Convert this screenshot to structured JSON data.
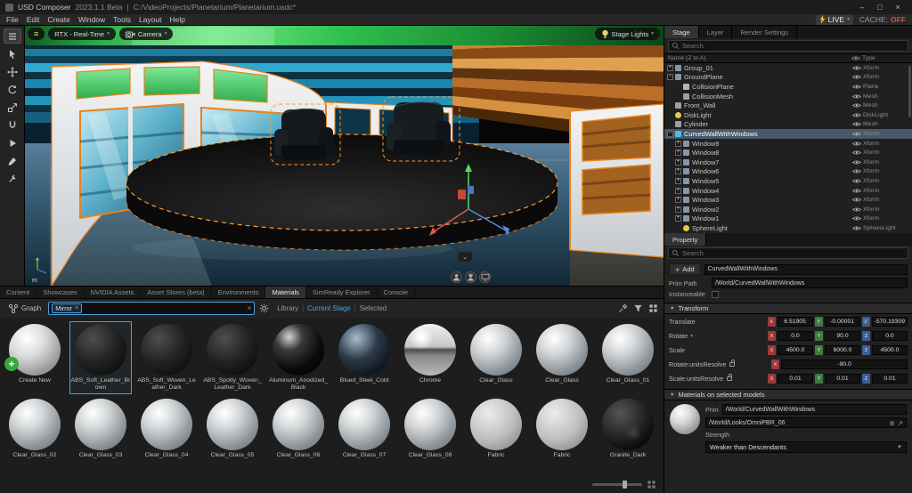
{
  "titlebar": {
    "app": "USD Composer",
    "version": "2023.1.1 Beta",
    "sep": "|",
    "path": "C:/VideoProjects/Planetarium/Planetarium.usdc*",
    "min": "–",
    "max": "□",
    "close": "×"
  },
  "menubar": {
    "items": [
      "File",
      "Edit",
      "Create",
      "Window",
      "Tools",
      "Layout",
      "Help"
    ],
    "live_label": "LIVE",
    "cache_label": "CACHE:",
    "cache_value": "OFF"
  },
  "ui": {
    "caret_down": "▼",
    "caret_small": "▾",
    "separator": "|",
    "close_x": "×",
    "plus": "+",
    "hamburger": "≡",
    "chevron_down": "⌄"
  },
  "toolbar": {
    "tools": [
      "menu",
      "select",
      "move",
      "rotate",
      "scale",
      "snap",
      "play",
      "paint",
      "wrench"
    ]
  },
  "viewport": {
    "renderer": "RTX - Real-Time",
    "camera_label": "Camera",
    "stage_lights_label": "Stage Lights",
    "axis_unit": "m"
  },
  "stage_panel": {
    "tabs": [
      {
        "label": "Stage",
        "active": true
      },
      {
        "label": "Layer"
      },
      {
        "label": "Render Settings"
      }
    ],
    "search_placeholder": "Search",
    "name_column": "Name (Z to A)",
    "type_column": "Type",
    "rows": [
      {
        "name": "Group_01",
        "type": "Xform",
        "indent": 0,
        "expand": "closed",
        "icon": "xform"
      },
      {
        "name": "GroundPlane",
        "type": "Xform",
        "indent": 0,
        "expand": "open",
        "icon": "xform"
      },
      {
        "name": "CollisionPlane",
        "type": "Plane",
        "indent": 1,
        "expand": "none",
        "icon": "plane"
      },
      {
        "name": "CollisionMesh",
        "type": "Mesh",
        "indent": 1,
        "expand": "none",
        "icon": "mesh"
      },
      {
        "name": "Front_Wall",
        "type": "Mesh",
        "indent": 0,
        "expand": "none",
        "icon": "mesh"
      },
      {
        "name": "DiskLight",
        "type": "DiskLight",
        "indent": 0,
        "expand": "none",
        "icon": "light"
      },
      {
        "name": "Cylinder",
        "type": "Mesh",
        "indent": 0,
        "expand": "none",
        "icon": "mesh"
      },
      {
        "name": "CurvedWallWithWindows",
        "type": "Xform",
        "indent": 0,
        "expand": "open",
        "icon": "xform-selected",
        "selected": true
      },
      {
        "name": "Window9",
        "type": "Xform",
        "indent": 1,
        "expand": "closed",
        "icon": "xform"
      },
      {
        "name": "Window8",
        "type": "Xform",
        "indent": 1,
        "expand": "closed",
        "icon": "xform"
      },
      {
        "name": "Window7",
        "type": "Xform",
        "indent": 1,
        "expand": "closed",
        "icon": "xform"
      },
      {
        "name": "Window6",
        "type": "Xform",
        "indent": 1,
        "expand": "closed",
        "icon": "xform"
      },
      {
        "name": "Window5",
        "type": "Xform",
        "indent": 1,
        "expand": "closed",
        "icon": "xform"
      },
      {
        "name": "Window4",
        "type": "Xform",
        "indent": 1,
        "expand": "closed",
        "icon": "xform"
      },
      {
        "name": "Window3",
        "type": "Xform",
        "indent": 1,
        "expand": "closed",
        "icon": "xform"
      },
      {
        "name": "Window2",
        "type": "Xform",
        "indent": 1,
        "expand": "closed",
        "icon": "xform"
      },
      {
        "name": "Window1",
        "type": "Xform",
        "indent": 1,
        "expand": "closed",
        "icon": "xform"
      },
      {
        "name": "SphereLight",
        "type": "SphereLight",
        "indent": 1,
        "expand": "none",
        "icon": "light"
      }
    ]
  },
  "property_panel": {
    "tab": "Property",
    "search_placeholder": "Search",
    "add_label": "Add",
    "prim_name": "CurvedWallWithWindows",
    "prim_path_label": "Prim Path",
    "prim_path": "/World/CurvedWallWithWindows",
    "instanceable_label": "Instanceable",
    "transform": {
      "title": "Transform",
      "rows": [
        {
          "label": "Translate",
          "fields": [
            [
              "X",
              "6.51905"
            ],
            [
              "Y",
              "-0.00001"
            ],
            [
              "Z",
              "-570.19309"
            ]
          ]
        },
        {
          "label": "Rotate",
          "caret": true,
          "fields": [
            [
              "X",
              "0.0"
            ],
            [
              "Y",
              "90.0"
            ],
            [
              "Z",
              "0.0"
            ]
          ]
        },
        {
          "label": "Scale",
          "fields": [
            [
              "X",
              "4500.0"
            ],
            [
              "Y",
              "6000.0"
            ],
            [
              "Z",
              "4500.0"
            ]
          ]
        },
        {
          "label": "Rotate:unitsResolve",
          "lock": true,
          "wide": true,
          "fields": [
            [
              "X",
              "-90.0"
            ]
          ]
        },
        {
          "label": "Scale:unitsResolve",
          "lock": true,
          "fields": [
            [
              "X",
              "0.01"
            ],
            [
              "Y",
              "0.01"
            ],
            [
              "Z",
              "0.01"
            ]
          ]
        }
      ]
    },
    "materials_section": {
      "title": "Materials on selected models",
      "prim_label": "Prim",
      "prim_value": "/World/CurvedWallWithWindows",
      "material_path": "/World/Looks/OmniPBR_06",
      "remove_icon": "⊗",
      "goto_icon": "↗",
      "strength_label": "Strength",
      "strength_value": "Weaker than Descendants"
    }
  },
  "bottom_panel": {
    "tabs": [
      {
        "label": "Content"
      },
      {
        "label": "Showcases"
      },
      {
        "label": "NVIDIA Assets"
      },
      {
        "label": "Asset Stores (beta)"
      },
      {
        "label": "Environments"
      },
      {
        "label": "Materials",
        "active": true
      },
      {
        "label": "SimReady Explorer"
      },
      {
        "label": "Console"
      }
    ],
    "graph_label": "Graph",
    "search_chip": "Mirror",
    "links": [
      {
        "label": "Library"
      },
      {
        "label": "Current Stage",
        "active": true
      },
      {
        "label": "Selected"
      }
    ],
    "materials": [
      {
        "name": "Create New",
        "style": "new"
      },
      {
        "name": "ABS_Soft_Leather_Brown",
        "style": "dark",
        "selected": true
      },
      {
        "name": "ABS_Soft_Woven_Leather_Dark",
        "style": "dark"
      },
      {
        "name": "ABS_Spotty_Woven_Leather_Dark",
        "style": "dark"
      },
      {
        "name": "Aluminum_Anodized_Black",
        "style": "blackgloss"
      },
      {
        "name": "Blued_Steel_Cold",
        "style": "bluesteel"
      },
      {
        "name": "Chrome",
        "style": "chrome"
      },
      {
        "name": "Clear_Glass",
        "style": "glass"
      },
      {
        "name": "Clear_Glass",
        "style": "glass"
      },
      {
        "name": "Clear_Glass_01",
        "style": "glass"
      },
      {
        "name": "Clear_Glass_02",
        "style": "glass"
      },
      {
        "name": "Clear_Glass_03",
        "style": "glass"
      },
      {
        "name": "Clear_Glass_04",
        "style": "glass"
      },
      {
        "name": "Clear_Glass_05",
        "style": "glass"
      },
      {
        "name": "Clear_Glass_06",
        "style": "glass"
      },
      {
        "name": "Clear_Glass_07",
        "style": "glass"
      },
      {
        "name": "Clear_Glass_08",
        "style": "glass"
      },
      {
        "name": "Fabric",
        "style": "fabric"
      },
      {
        "name": "Fabric",
        "style": "fabric"
      },
      {
        "name": "Granite_Dark",
        "style": "granite"
      }
    ]
  },
  "colors": {
    "accent_orange": "#e8821e",
    "selection_blue": "#4aa3e0",
    "axis_x": "#a03838",
    "axis_y": "#3f7a3f",
    "axis_z": "#3a5f9a",
    "live_yellow": "#f0c030",
    "cache_off_red": "#e0502e",
    "stage_green": "#35c555"
  }
}
